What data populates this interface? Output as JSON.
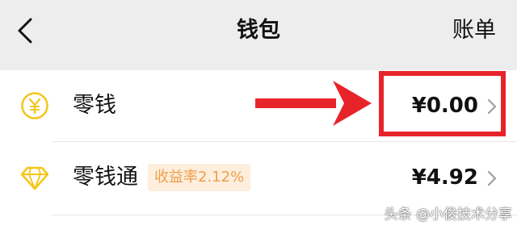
{
  "header": {
    "title": "钱包",
    "right_label": "账单"
  },
  "rows": [
    {
      "label": "零钱",
      "amount": "¥0.00",
      "icon": "yuan-coin-icon"
    },
    {
      "label": "零钱通",
      "badge": "收益率2.12%",
      "amount": "¥4.92",
      "icon": "diamond-icon"
    }
  ],
  "watermark": "头条 @小俊技术分享",
  "colors": {
    "accent_yellow": "#f5c518",
    "highlight_red": "#e8242b",
    "badge_bg": "#fdeedd",
    "badge_text": "#f0a04a"
  }
}
